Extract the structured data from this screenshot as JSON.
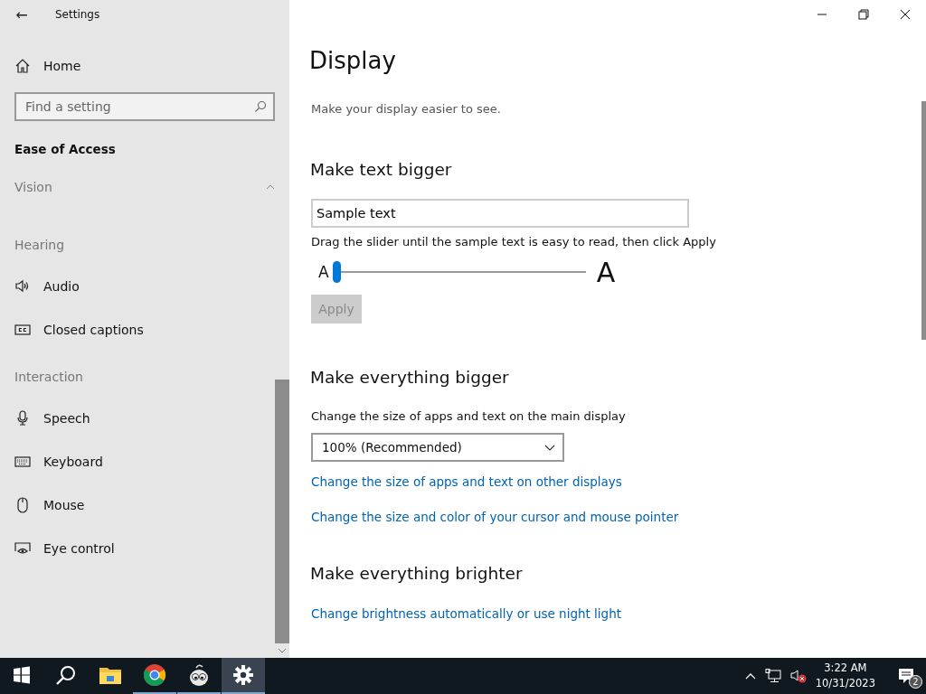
{
  "window": {
    "title": "Settings",
    "back": "←"
  },
  "sidebar": {
    "home": "Home",
    "search": {
      "placeholder": "Find a setting"
    },
    "category": "Ease of Access",
    "items": [
      {
        "kind": "header",
        "label": "Vision",
        "expanded": true
      },
      {
        "kind": "header",
        "label": "Hearing"
      },
      {
        "kind": "item",
        "label": "Audio"
      },
      {
        "kind": "item",
        "label": "Closed captions"
      },
      {
        "kind": "header",
        "label": "Interaction"
      },
      {
        "kind": "item",
        "label": "Speech"
      },
      {
        "kind": "item",
        "label": "Keyboard"
      },
      {
        "kind": "item",
        "label": "Mouse"
      },
      {
        "kind": "item",
        "label": "Eye control"
      }
    ]
  },
  "page": {
    "title": "Display",
    "subtitle": "Make your display easier to see.",
    "text_section": {
      "heading": "Make text bigger",
      "sample": "Sample text",
      "hint": "Drag the slider until the sample text is easy to read, then click Apply",
      "small_a": "A",
      "large_a": "A",
      "slider": {
        "level": 0
      },
      "apply": {
        "label": "Apply",
        "disabled": true
      }
    },
    "bigger_section": {
      "heading": "Make everything bigger",
      "label": "Change the size of apps and text on the main display",
      "dropdown": "100% (Recommended)",
      "links": [
        "Change the size of apps and text on other displays",
        "Change the size and color of your cursor and mouse pointer"
      ]
    },
    "brighter_section": {
      "heading": "Make everything brighter",
      "links": [
        "Change brightness automatically or use night light"
      ]
    }
  },
  "taskbar": {
    "apps": [
      {
        "kind": "start",
        "running": false,
        "selected": false
      },
      {
        "kind": "search",
        "running": false,
        "selected": false
      },
      {
        "kind": "explorer",
        "running": false,
        "selected": false
      },
      {
        "kind": "browser",
        "running": true,
        "selected": false
      },
      {
        "kind": "eyes",
        "running": true,
        "selected": false
      },
      {
        "kind": "settings",
        "running": true,
        "selected": true
      }
    ],
    "time": "3:22 AM",
    "date": "10/31/2023",
    "notifications": "2"
  }
}
